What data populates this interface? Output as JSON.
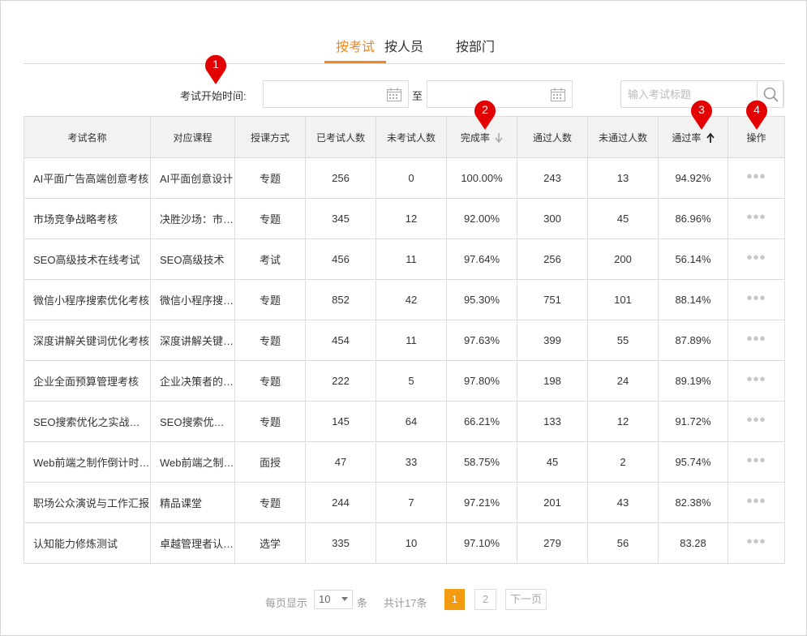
{
  "tabs": [
    {
      "label": "按考试",
      "active": true
    },
    {
      "label": "按人员",
      "active": false
    },
    {
      "label": "按部门",
      "active": false
    }
  ],
  "filter": {
    "start_label": "考试开始时间:",
    "to_label": "至",
    "start_value": "",
    "end_value": "",
    "search_placeholder": "输入考试标题",
    "search_value": ""
  },
  "table": {
    "columns": [
      "考试名称",
      "对应课程",
      "授课方式",
      "已考试人数",
      "未考试人数",
      "完成率",
      "通过人数",
      "未通过人数",
      "通过率",
      "操作"
    ],
    "sort": {
      "完成率": "down-icon-gray",
      "通过率": "up-icon-dark"
    },
    "rows": [
      [
        "AI平面广告高端创意考核",
        "AI平面创意设计",
        "专题",
        "256",
        "0",
        "100.00%",
        "243",
        "13",
        "94.92%",
        "•••"
      ],
      [
        "市场竞争战略考核",
        "决胜沙场：市场竞争战略",
        "专题",
        "345",
        "12",
        "92.00%",
        "300",
        "45",
        "86.96%",
        "•••"
      ],
      [
        "SEO高级技术在线考试",
        "SEO高级技术",
        "考试",
        "456",
        "11",
        "97.64%",
        "256",
        "200",
        "56.14%",
        "•••"
      ],
      [
        "微信小程序搜索优化考核",
        "微信小程序搜索优化",
        "专题",
        "852",
        "42",
        "95.30%",
        "751",
        "101",
        "88.14%",
        "•••"
      ],
      [
        "深度讲解关键词优化考核",
        "深度讲解关键词优化",
        "专题",
        "454",
        "11",
        "97.63%",
        "399",
        "55",
        "87.89%",
        "•••"
      ],
      [
        "企业全面预算管理考核",
        "企业决策者的全面预算",
        "专题",
        "222",
        "5",
        "97.80%",
        "198",
        "24",
        "89.19%",
        "•••"
      ],
      [
        "SEO搜索优化之实战考核",
        "SEO搜索优化之实战",
        "专题",
        "145",
        "64",
        "66.21%",
        "133",
        "12",
        "91.72%",
        "•••"
      ],
      [
        "Web前端之制作倒计时考核",
        "Web前端之制作倒计时",
        "面授",
        "47",
        "33",
        "58.75%",
        "45",
        "2",
        "95.74%",
        "•••"
      ],
      [
        "职场公众演说与工作汇报",
        "精品课堂",
        "专题",
        "244",
        "7",
        "97.21%",
        "201",
        "43",
        "82.38%",
        "•••"
      ],
      [
        "认知能力修炼测试",
        "卓越管理者认知能力修炼",
        "选学",
        "335",
        "10",
        "97.10%",
        "279",
        "56",
        "83.28",
        "•••"
      ]
    ]
  },
  "markers": [
    "1",
    "2",
    "3",
    "4"
  ],
  "pagination": {
    "per_page_label": "每页显示",
    "per_page_value": "10",
    "unit_label": "条",
    "total_label": "共计17条",
    "pages": [
      "1",
      "2"
    ],
    "current_page": "1",
    "next_label": "下一页"
  },
  "colors": {
    "accent": "#f0861e",
    "marker": "#e30000",
    "page_active": "#f39c12"
  }
}
